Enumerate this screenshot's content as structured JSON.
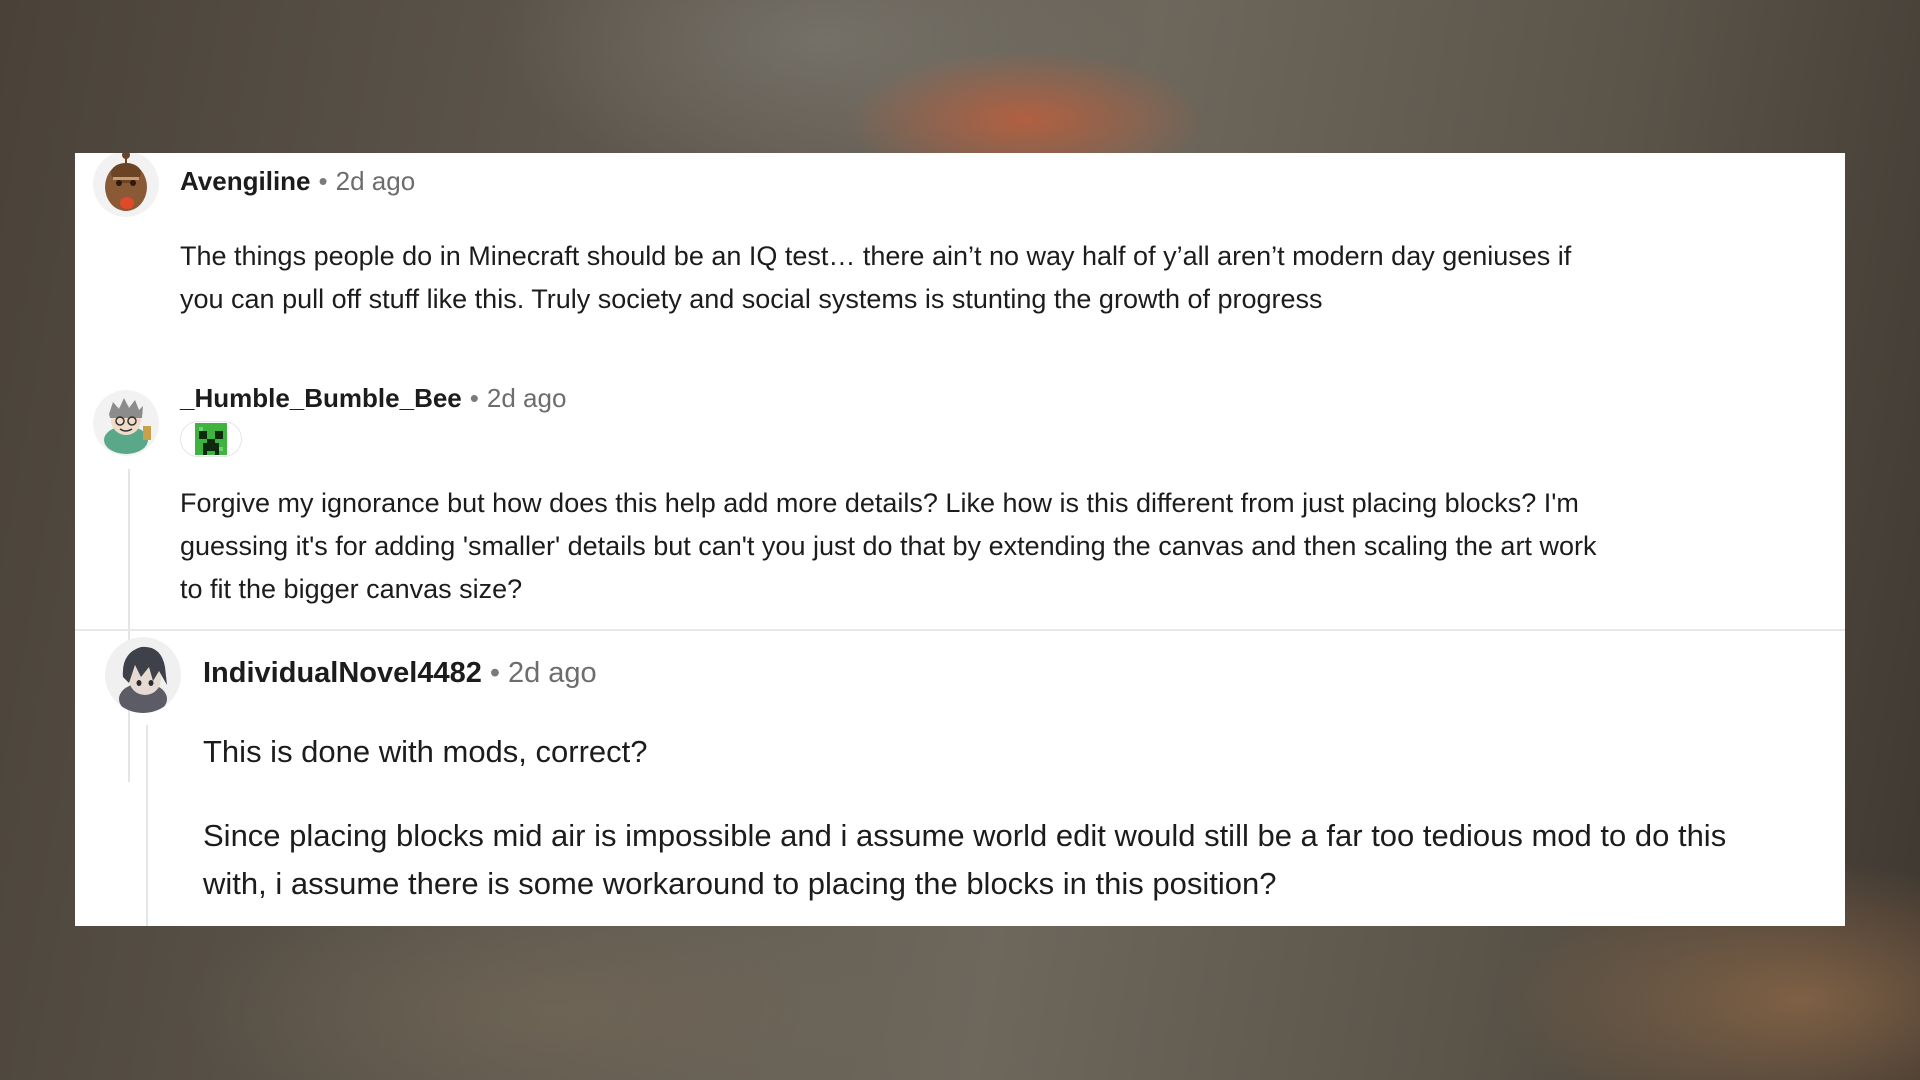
{
  "comments": [
    {
      "username": "Avengiline",
      "time": "2d ago",
      "avatar_icon": "snoo-avatar-icon",
      "body": "The things people do in Minecraft should be an IQ test… there ain’t no way half of y’all aren’t modern day geniuses if you can pull off stuff like this. Truly society and social systems is stunting the growth of progress"
    },
    {
      "username": "_Humble_Bumble_Bee",
      "time": "2d ago",
      "avatar_icon": "snoo-avatar-icon",
      "flair_icon": "creeper-face-icon",
      "body": "Forgive my ignorance but how does this help add more details? Like how is this different from just placing blocks? I'm guessing it's for adding 'smaller' details but can't you just do that by extending the canvas and then scaling the art work to fit the bigger canvas size?"
    },
    {
      "username": "IndividualNovel4482",
      "time": "2d ago",
      "avatar_icon": "snoo-avatar-icon",
      "paragraphs": [
        "This is done with mods, correct?",
        "Since placing blocks mid air is impossible and i assume world edit would still be a far too tedious mod to do this with, i assume there is some workaround to placing the blocks in this position?"
      ]
    }
  ],
  "separator": "•"
}
